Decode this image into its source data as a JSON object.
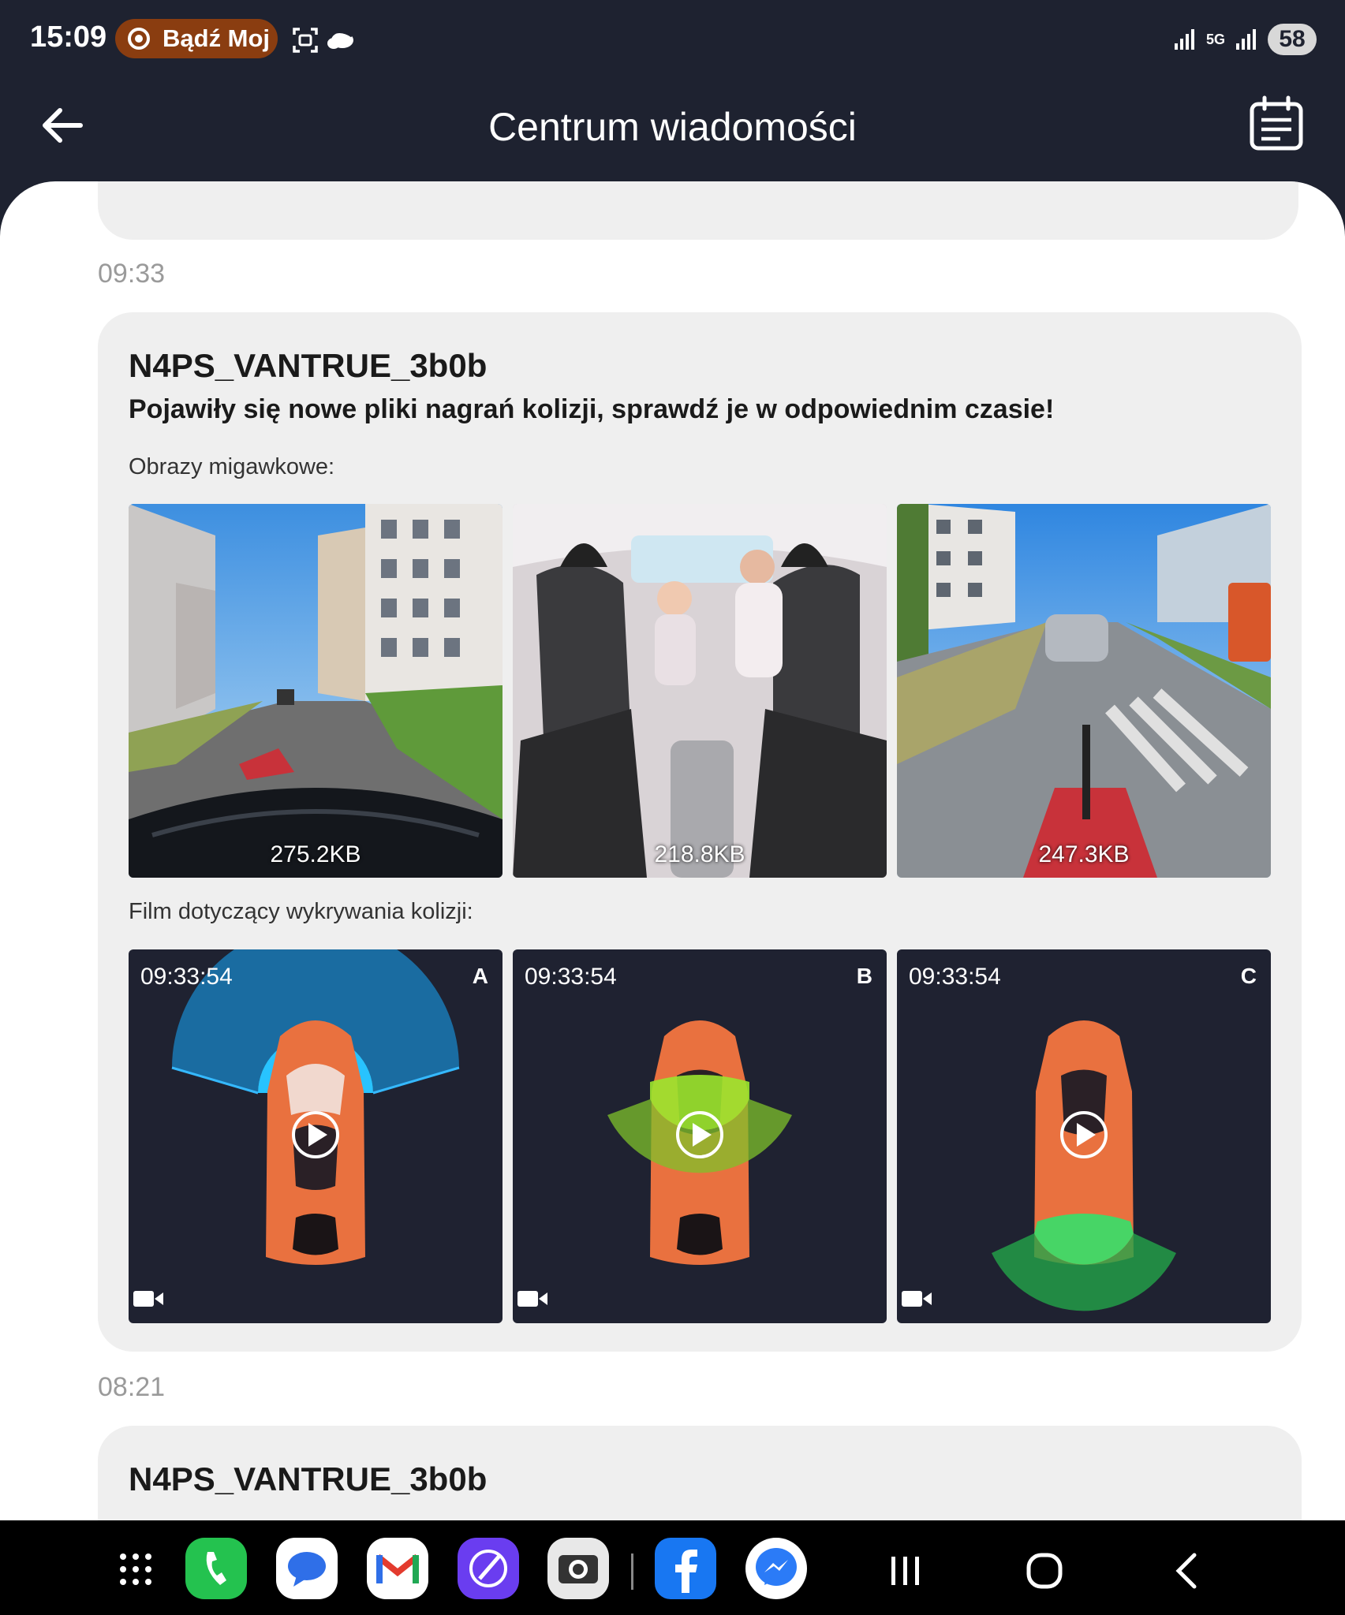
{
  "status_bar": {
    "time": "15:09",
    "notification_pill": "Bądź Moj",
    "battery": "58",
    "network_label": "5G"
  },
  "header": {
    "title": "Centrum wiadomości",
    "back_icon": "arrow-left-icon",
    "calendar_icon": "calendar-list-icon"
  },
  "messages": [
    {
      "time": "09:33",
      "device": "N4PS_VANTRUE_3b0b",
      "text": "Pojawiły się nowe pliki nagrań kolizji, sprawdź je w odpowiednim czasie!",
      "snapshots_label": "Obrazy migawkowe:",
      "snapshots": [
        {
          "size": "275.2KB",
          "scene": "front-street"
        },
        {
          "size": "218.8KB",
          "scene": "cabin-interior"
        },
        {
          "size": "247.3KB",
          "scene": "rear-street"
        }
      ],
      "video_label": "Film dotyczący wykrywania kolizji:",
      "videos": [
        {
          "time": "09:33:54",
          "channel": "A",
          "zone": "front"
        },
        {
          "time": "09:33:54",
          "channel": "B",
          "zone": "middle"
        },
        {
          "time": "09:33:54",
          "channel": "C",
          "zone": "rear"
        }
      ]
    },
    {
      "time": "08:21",
      "device": "N4PS_VANTRUE_3b0b"
    }
  ],
  "dock": {
    "apps": [
      "apps-grid-icon",
      "phone-icon",
      "messages-icon",
      "gmail-icon",
      "notes-icon",
      "camera-icon",
      "facebook-icon",
      "messenger-icon"
    ],
    "nav": [
      "recents-icon",
      "home-icon",
      "back-nav-icon"
    ]
  },
  "colors": {
    "dark_bg": "#1e2230",
    "card_bg": "#efefef",
    "car_orange": "#e9713f",
    "zone_blue": "#1aa8e0",
    "zone_green": "#2fd15a"
  }
}
